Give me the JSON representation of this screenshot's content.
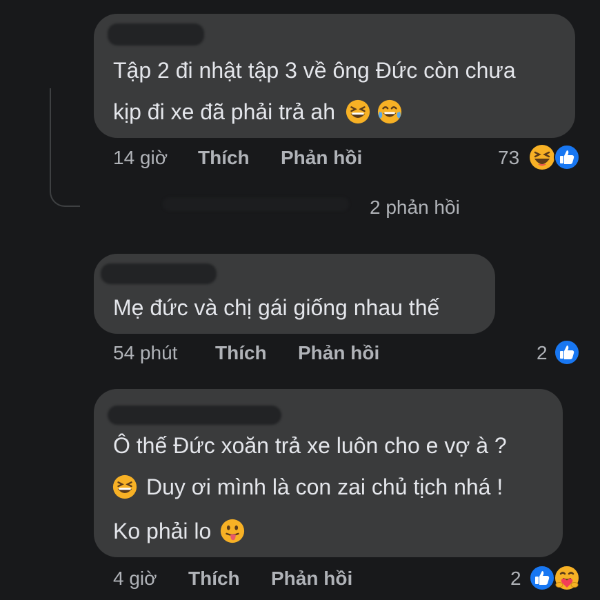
{
  "comments": [
    {
      "text_lines": [
        "Tập 2 đi nhật tập 3 về ông Đức còn chưa",
        "kịp đi xe đã phải trả ah"
      ],
      "emojis_line2": [
        "grinning-squinting-emoji",
        "tears-of-joy-emoji"
      ],
      "time": "14 giờ",
      "like_label": "Thích",
      "reply_label": "Phản hồi",
      "reaction_count": "73",
      "reactions": [
        "haha-reaction",
        "like-reaction"
      ],
      "replies_link": "2 phản hồi"
    },
    {
      "text_lines": [
        "Mẹ đức và chị gái giống nhau thế"
      ],
      "time": "54 phút",
      "like_label": "Thích",
      "reply_label": "Phản hồi",
      "reaction_count": "2",
      "reactions": [
        "like-reaction"
      ]
    },
    {
      "text_lines": [
        "Ô thế Đức xoăn trả xe luôn cho e vợ à ?",
        "Duy ơi mình là con zai chủ tịch nhá !",
        "Ko phải lo"
      ],
      "emojis": [
        "grinning-squinting-emoji",
        "tongue-out-emoji"
      ],
      "time": "4 giờ",
      "like_label": "Thích",
      "reply_label": "Phản hồi",
      "reaction_count": "2",
      "reactions": [
        "like-reaction",
        "care-reaction"
      ]
    }
  ],
  "colors": {
    "background": "#18191b",
    "bubble": "#3a3b3c",
    "text": "#e4e6eb",
    "secondary_text": "#b0b3b8",
    "like_blue": "#1877f2",
    "emoji_yellow": "#f7b125"
  }
}
